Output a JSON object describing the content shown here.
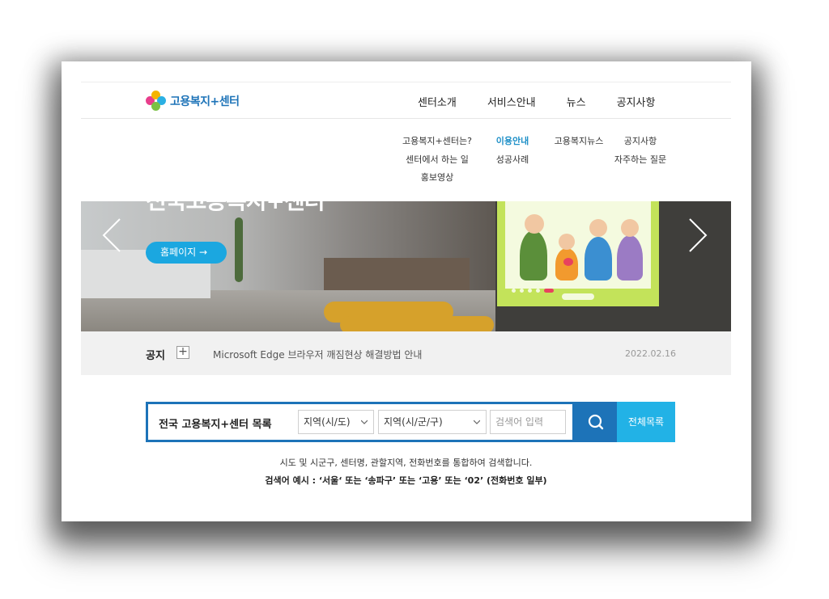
{
  "logo": {
    "text": "고용복지+센터"
  },
  "nav": [
    "센터소개",
    "서비스안내",
    "뉴스",
    "공지사항"
  ],
  "dropdown": {
    "col1": [
      "고용복지+센터는?",
      "센터에서 하는 일",
      "홍보영상"
    ],
    "col2": [
      "이용안내",
      "성공사례"
    ],
    "col3": [
      "고용복지뉴스"
    ],
    "col4": [
      "공지사항",
      "자주하는 질문"
    ],
    "active": "이용안내"
  },
  "banner": {
    "title": "전국고용복지+센터",
    "button": "홈페이지 →"
  },
  "notice": {
    "label": "공지",
    "plus": "+",
    "text": "Microsoft Edge 브라우저 깨짐현상 해결방법 안내",
    "date": "2022.02.16"
  },
  "search": {
    "title": "전국 고용복지+센터 목록",
    "region1": "지역(시/도)",
    "region2": "지역(시/군/구)",
    "placeholder": "검색어 입력",
    "all_button": "전체목록"
  },
  "help": {
    "line1": "시도 및 시군구, 센터명, 관할지역, 전화번호를 통합하여 검색합니다.",
    "line2": "검색어 예시 : ‘서울‘ 또는 ‘송파구’ 또는 ‘고용’ 또는 ‘02’ (전화번호 일부)"
  },
  "colors": {
    "primary": "#1d73b8",
    "accent": "#22b2e6",
    "active_menu": "#1d8fc7"
  }
}
